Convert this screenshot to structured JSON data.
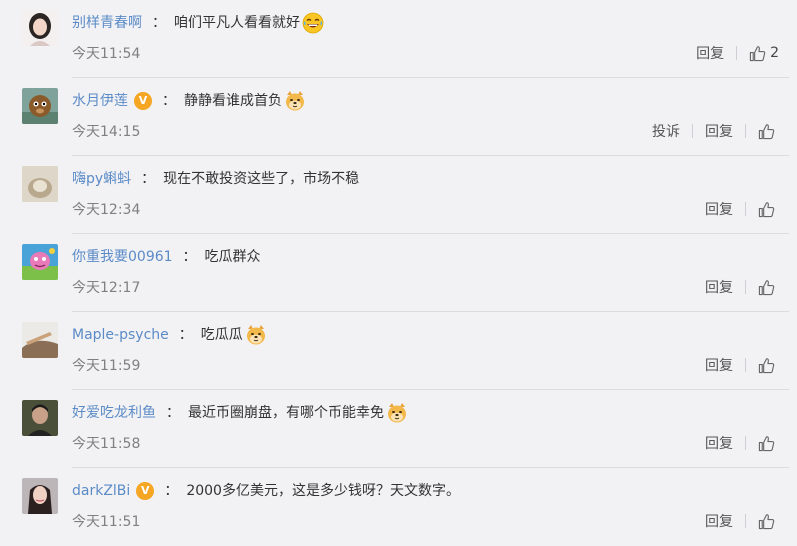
{
  "comments": [
    {
      "user": "别样青春啊",
      "verified": false,
      "text": "咱们平凡人看看就好",
      "emoji": "laughing-tears-emoji",
      "time": "今天11:54",
      "report": "",
      "reply": "回复",
      "likes": "2"
    },
    {
      "user": "水月伊莲",
      "verified": true,
      "text": "静静看谁成首负",
      "emoji": "doge-emoji",
      "time": "今天14:15",
      "report": "投诉",
      "reply": "回复",
      "likes": ""
    },
    {
      "user": "嗨py蝌蚪",
      "verified": false,
      "text": "现在不敢投资这些了，市场不稳",
      "emoji": "",
      "time": "今天12:34",
      "report": "",
      "reply": "回复",
      "likes": ""
    },
    {
      "user": "你重我要00961",
      "verified": false,
      "text": "吃瓜群众",
      "emoji": "",
      "time": "今天12:17",
      "report": "",
      "reply": "回复",
      "likes": ""
    },
    {
      "user": "Maple-psyche",
      "verified": false,
      "text": "吃瓜瓜",
      "emoji": "doge-emoji",
      "time": "今天11:59",
      "report": "",
      "reply": "回复",
      "likes": ""
    },
    {
      "user": "好爱吃龙利鱼",
      "verified": false,
      "text": "最近币圈崩盘，有哪个币能幸免",
      "emoji": "doge-emoji",
      "time": "今天11:58",
      "report": "",
      "reply": "回复",
      "likes": ""
    },
    {
      "user": "darkZlBi",
      "verified": true,
      "text": "2000多亿美元，这是多少钱呀？天文数字。",
      "emoji": "",
      "time": "今天11:51",
      "report": "",
      "reply": "回复",
      "likes": ""
    }
  ],
  "colon": "：",
  "colors": {
    "username": "#5b8bc7",
    "badge": "#f5a623",
    "background": "#f2f2f5"
  }
}
